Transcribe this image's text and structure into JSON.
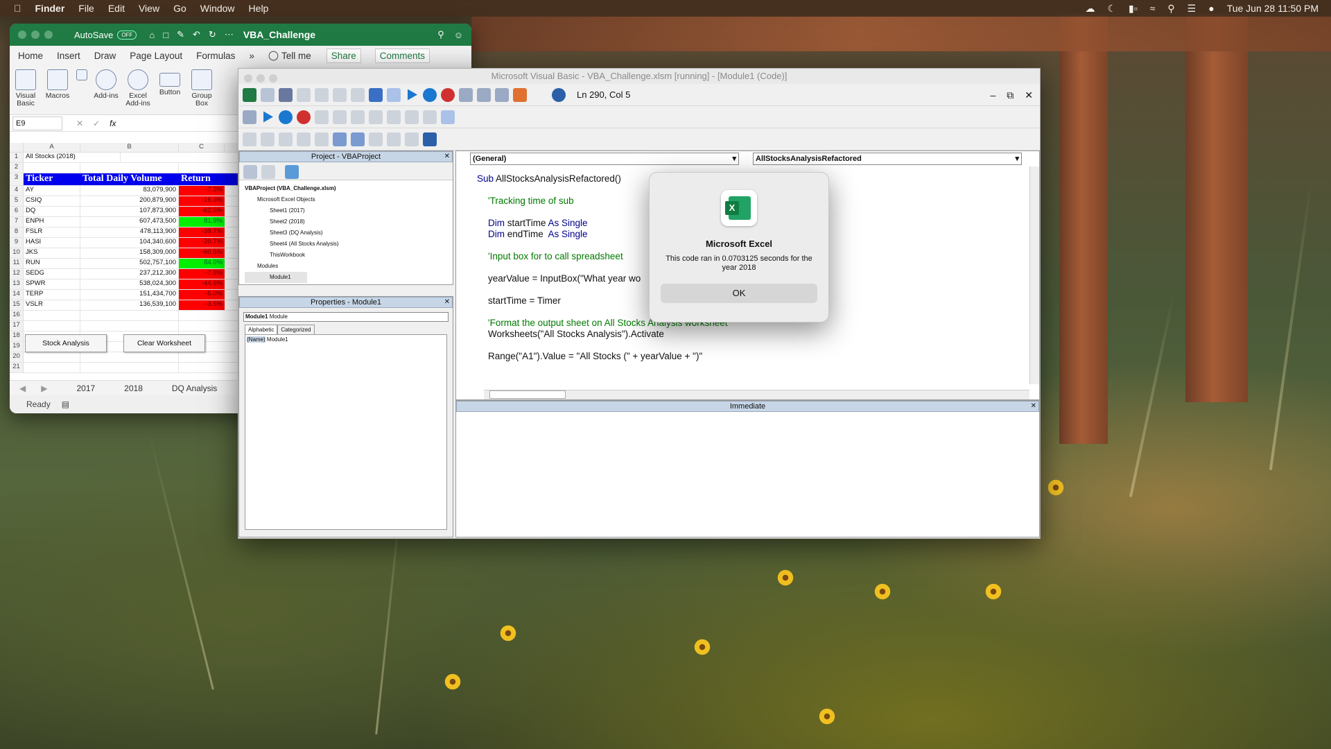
{
  "menubar": {
    "app": "Finder",
    "items": [
      "File",
      "Edit",
      "View",
      "Go",
      "Window",
      "Help"
    ],
    "clock": "Tue Jun 28  11:50 PM"
  },
  "excel": {
    "autosave": "AutoSave",
    "autosave_state": "OFF",
    "filename": "VBA_Challenge",
    "tabs": [
      "Home",
      "Insert",
      "Draw",
      "Page Layout",
      "Formulas"
    ],
    "tellme": "Tell me",
    "share": "Share",
    "comments": "Comments",
    "ribbon": [
      "Visual Basic",
      "Macros",
      "Add-ins",
      "Excel Add-ins",
      "Button",
      "Group Box"
    ],
    "namebox": "E9",
    "fx": "fx",
    "columns": [
      "A",
      "B",
      "C"
    ],
    "title_cell": "All Stocks (2018)",
    "headers": [
      "Ticker",
      "Total Daily Volume",
      "Return"
    ],
    "rows": [
      {
        "r": "4",
        "t": "AY",
        "v": "83,079,900",
        "ret": "-7.3%",
        "pos": false
      },
      {
        "r": "5",
        "t": "CSIQ",
        "v": "200,879,900",
        "ret": "-16.3%",
        "pos": false
      },
      {
        "r": "6",
        "t": "DQ",
        "v": "107,873,900",
        "ret": "-62.6%",
        "pos": false
      },
      {
        "r": "7",
        "t": "ENPH",
        "v": "607,473,500",
        "ret": "81.9%",
        "pos": true
      },
      {
        "r": "8",
        "t": "FSLR",
        "v": "478,113,900",
        "ret": "-39.7%",
        "pos": false
      },
      {
        "r": "9",
        "t": "HASI",
        "v": "104,340,600",
        "ret": "-20.7%",
        "pos": false
      },
      {
        "r": "10",
        "t": "JKS",
        "v": "158,309,000",
        "ret": "-60.5%",
        "pos": false
      },
      {
        "r": "11",
        "t": "RUN",
        "v": "502,757,100",
        "ret": "84.0%",
        "pos": true
      },
      {
        "r": "12",
        "t": "SEDG",
        "v": "237,212,300",
        "ret": "-7.8%",
        "pos": false
      },
      {
        "r": "13",
        "t": "SPWR",
        "v": "538,024,300",
        "ret": "-44.6%",
        "pos": false
      },
      {
        "r": "14",
        "t": "TERP",
        "v": "151,434,700",
        "ret": "-5.0%",
        "pos": false
      },
      {
        "r": "15",
        "t": "VSLR",
        "v": "136,539,100",
        "ret": "-3.5%",
        "pos": false
      }
    ],
    "extra_rows": [
      "16",
      "17",
      "18",
      "19",
      "20",
      "21"
    ],
    "buttons": {
      "stock": "Stock Analysis",
      "clear": "Clear Worksheet"
    },
    "sheets": [
      "2017",
      "2018",
      "DQ Analysis"
    ],
    "status": "Ready"
  },
  "vbe": {
    "title": "Microsoft Visual Basic - VBA_Challenge.xlsm [running] - [Module1 (Code)]",
    "position": "Ln 290, Col 5",
    "project_title": "Project - VBAProject",
    "tree": [
      "VBAProject (VBA_Challenge.xlsm)",
      "Microsoft Excel Objects",
      "Sheet1 (2017)",
      "Sheet2 (2018)",
      "Sheet3 (DQ Analysis)",
      "Sheet4 (All Stocks Analysis)",
      "ThisWorkbook",
      "Modules",
      "Module1"
    ],
    "properties_title": "Properties - Module1",
    "props_select": "Module1",
    "props_select_type": "Module",
    "props_tabs": [
      "Alphabetic",
      "Categorized"
    ],
    "props_name_key": "(Name)",
    "props_name_val": "Module1",
    "general": "(General)",
    "proc": "AllStocksAnalysisRefactored",
    "code": {
      "l1kw": "Sub",
      "l1": " AllStocksAnalysisRefactored()",
      "c1": "'Tracking time of sub",
      "d1kw": "Dim",
      "d1": " startTime ",
      "d1as": "As Single",
      "d2kw": "Dim",
      "d2": " endTime  ",
      "d2as": "As Single",
      "c2": "'Input box for to call spreadsheet",
      "l5": "yearValue = InputBox(\"What year wo",
      "l6": "startTime = Timer",
      "c3": "'Format the output sheet on All Stocks Analysis worksheet",
      "l8": "Worksheets(\"All Stocks Analysis\").Activate",
      "l9": "Range(\"A1\").Value = \"All Stocks (\" + yearValue + \")\""
    },
    "immediate": "Immediate"
  },
  "dialog": {
    "title": "Microsoft Excel",
    "message": "This code ran in 0.0703125 seconds for the year 2018",
    "ok": "OK"
  }
}
